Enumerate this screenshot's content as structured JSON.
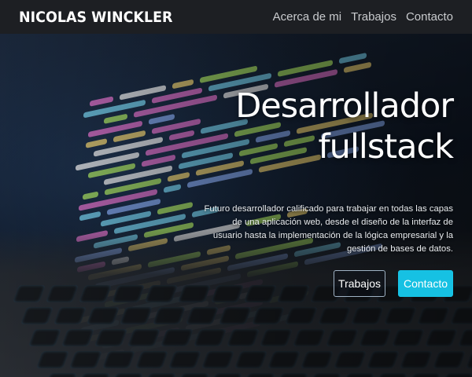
{
  "navbar": {
    "brand": "NICOLAS WINCKLER",
    "links": [
      {
        "label": "Acerca de mi"
      },
      {
        "label": "Trabajos"
      },
      {
        "label": "Contacto"
      }
    ]
  },
  "hero": {
    "title_line1": "Desarrollador",
    "title_line2": "fullstack",
    "description": "Futuro desarrollador calificado para trabajar en todas las capas de una aplicación web, desde el diseño de la interfaz de usuario hasta la implementación de la lógica empresarial y la gestión de bases de datos.",
    "buttons": {
      "secondary_label": "Trabajos",
      "primary_label": "Contacto"
    }
  },
  "colors": {
    "navbar_bg": "#1d1f23",
    "accent": "#16c1e3",
    "brand_text": "#ffffff"
  }
}
